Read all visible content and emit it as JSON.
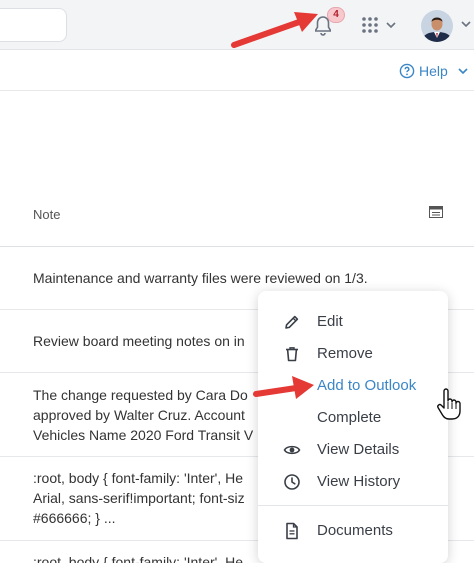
{
  "topbar": {
    "notification_count": "4",
    "icons": [
      "bell-icon",
      "apps-grid-icon",
      "chevron-down-icon",
      "avatar"
    ]
  },
  "help": {
    "label": "Help"
  },
  "table": {
    "column_header": "Note",
    "rows": [
      "Maintenance and warranty files were reviewed on 1/3.",
      "Review board meeting notes on in",
      "The change requested by Cara Do\napproved by Walter Cruz. Account\nVehicles Name 2020 Ford Transit V",
      ":root, body { font-family: 'Inter', He\nArial, sans-serif!important; font-siz\n#666666; } ...",
      ":root, body { font-family: 'Inter', He"
    ]
  },
  "context_menu": {
    "items": [
      {
        "label": "Edit",
        "icon": "pencil-icon"
      },
      {
        "label": "Remove",
        "icon": "trash-icon"
      },
      {
        "label": "Add to Outlook",
        "icon": ""
      },
      {
        "label": "Complete",
        "icon": ""
      },
      {
        "label": "View Details",
        "icon": "eye-icon"
      },
      {
        "label": "View History",
        "icon": "clock-icon"
      },
      {
        "label": "Documents",
        "icon": "document-icon"
      }
    ]
  },
  "colors": {
    "accent": "#3b86c6",
    "arrow": "#e53935",
    "topbar_bg": "#f3f4f6"
  }
}
